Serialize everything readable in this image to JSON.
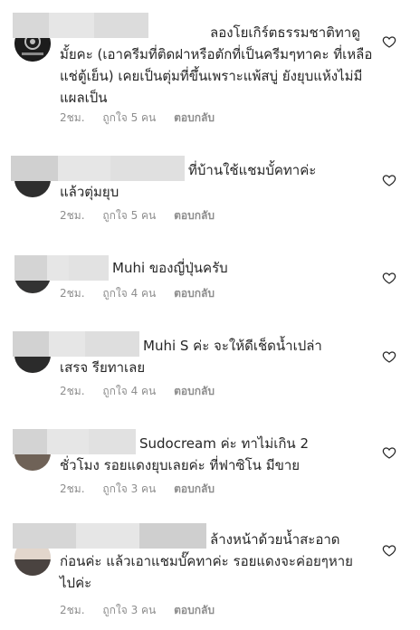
{
  "comments": [
    {
      "text": "ลองโยเกิร์ตธรรมชาติทาดูมั้ยคะ (เอาครีมที่ติดฝาหรือตักที่เป็นครีมๆทาคะ ที่เหลือแช่ตู้เย็น) เคยเป็นตุ่มที่ขึ้นเพราะแพ้สบู่ ยังยุบแห้งไม่มีแผลเป็น",
      "time": "2ชม.",
      "likes": "ถูกใจ 5 คน",
      "reply": "ตอบกลับ"
    },
    {
      "text": "ที่บ้านใช้แชมบั้คทาค่ะ แล้วตุ่มยุบ",
      "time": "2ชม.",
      "likes": "ถูกใจ 5 คน",
      "reply": "ตอบกลับ"
    },
    {
      "text": "Muhi ของญี่ปุ่นครับ",
      "time": "2ชม.",
      "likes": "ถูกใจ 4 คน",
      "reply": "ตอบกลับ"
    },
    {
      "text": "Muhi S ค่ะ จะให้ดีเช็ดน้ำเปล่าเสรจ รียทาเลย",
      "time": "2ชม.",
      "likes": "ถูกใจ 4 คน",
      "reply": "ตอบกลับ"
    },
    {
      "text": "Sudocream ค่ะ ทาไม่เกิน 2 ชั่วโมง รอยแดงยุบเลยค่ะ ที่ฟาซิโน มีขาย",
      "time": "2ชม.",
      "likes": "ถูกใจ 3 คน",
      "reply": "ตอบกลับ"
    },
    {
      "text": "ล้างหน้าด้วยน้ำสะอาดก่อนค่ะ แล้วเอาแชมบั๊คทาค่ะ รอยแดงจะค่อยๆหายไปค่ะ",
      "time": "2ชม.",
      "likes": "ถูกใจ 3 คน",
      "reply": "ตอบกลับ"
    }
  ]
}
